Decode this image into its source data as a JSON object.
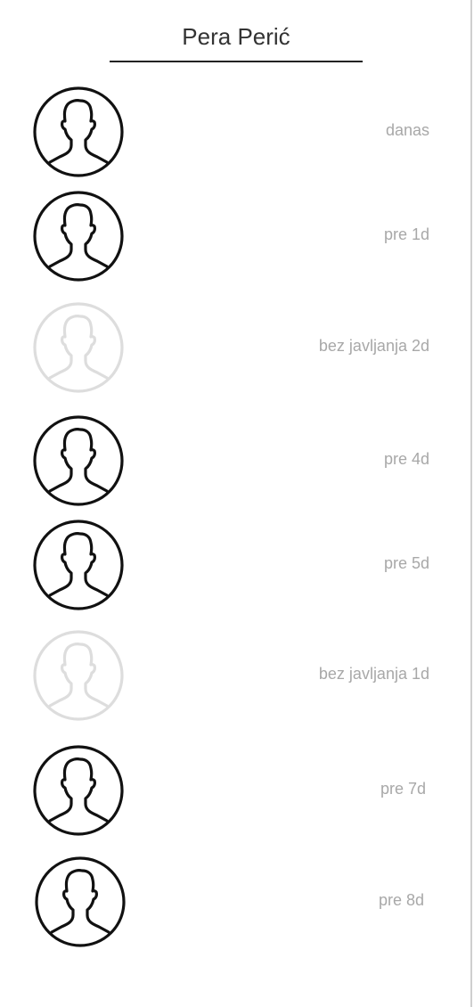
{
  "header": {
    "title": "Pera Perić"
  },
  "contacts": [
    {
      "status": "danas",
      "active": true
    },
    {
      "status": "pre 1d",
      "active": true
    },
    {
      "status": "bez javljanja 2d",
      "active": false
    },
    {
      "status": "pre 4d",
      "active": true
    },
    {
      "status": "pre 5d",
      "active": true
    },
    {
      "status": "bez javljanja 1d",
      "active": false
    },
    {
      "status": "pre 7d",
      "active": true
    },
    {
      "status": "pre 8d",
      "active": true
    }
  ],
  "icons": {
    "avatar": "user-silhouette-icon"
  },
  "colors": {
    "active_avatar": "#111111",
    "inactive_avatar": "#dddddd",
    "status_text": "#a8a8a8",
    "title_text": "#333333"
  }
}
